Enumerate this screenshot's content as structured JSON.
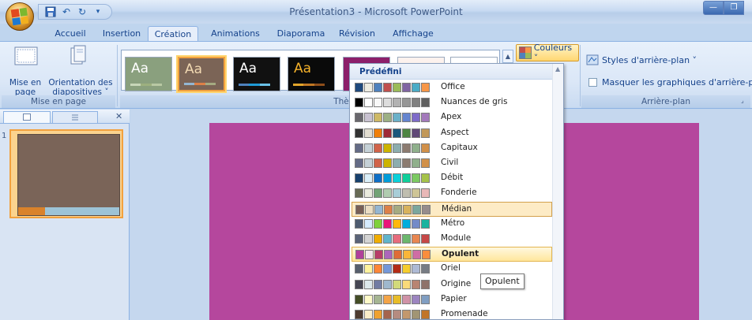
{
  "window": {
    "title": "Présentation3 - Microsoft PowerPoint"
  },
  "tabs": [
    {
      "label": "Accueil"
    },
    {
      "label": "Insertion"
    },
    {
      "label": "Création",
      "active": true
    },
    {
      "label": "Animations"
    },
    {
      "label": "Diaporama"
    },
    {
      "label": "Révision"
    },
    {
      "label": "Affichage"
    }
  ],
  "ribbon": {
    "page_group": {
      "mise_en_page_line1": "Mise en",
      "mise_en_page_line2": "page",
      "orientation_line1": "Orientation des",
      "orientation_line2": "diapositives ˅",
      "label": "Mise en page"
    },
    "themes_group": {
      "label": "Thè",
      "aa": "Aa"
    },
    "couleurs_label": "Couleurs ˅",
    "background_group": {
      "styles_label": "Styles d'arrière-plan ˅",
      "masquer_label": "Masquer les graphiques d'arrière-plan",
      "label": "Arrière-plan"
    }
  },
  "pane": {
    "slide_number": "1"
  },
  "dropdown": {
    "header": "Prédéfini",
    "items": [
      {
        "name": "Office",
        "colors": [
          "#1f497d",
          "#eeece1",
          "#4f81bd",
          "#c0504d",
          "#9bbb59",
          "#8064a2",
          "#4bacc6",
          "#f79646"
        ]
      },
      {
        "name": "Nuances de gris",
        "colors": [
          "#000000",
          "#ffffff",
          "#f8f8f8",
          "#dddddd",
          "#b2b2b2",
          "#969696",
          "#808080",
          "#5f5f5f"
        ]
      },
      {
        "name": "Apex",
        "colors": [
          "#69676d",
          "#c9c2d1",
          "#ceb966",
          "#9cb084",
          "#6bb1c9",
          "#6585cf",
          "#7e6bc9",
          "#a379bb"
        ]
      },
      {
        "name": "Aspect",
        "colors": [
          "#323232",
          "#e3ded1",
          "#f07f09",
          "#9f2936",
          "#1b587c",
          "#4e8542",
          "#604878",
          "#c19859"
        ]
      },
      {
        "name": "Capitaux",
        "colors": [
          "#646b86",
          "#c5d1d7",
          "#d16349",
          "#ccb400",
          "#8cadae",
          "#8c7b70",
          "#8fb08c",
          "#d19049"
        ]
      },
      {
        "name": "Civil",
        "colors": [
          "#646b86",
          "#c5d1d7",
          "#d16349",
          "#ccb400",
          "#8cadae",
          "#8c7b70",
          "#8fb08c",
          "#d19049"
        ]
      },
      {
        "name": "Débit",
        "colors": [
          "#17406d",
          "#dbeff9",
          "#0f6fc6",
          "#009dd9",
          "#0bd0d9",
          "#10cf9b",
          "#7cca62",
          "#a5c249"
        ]
      },
      {
        "name": "Fonderie",
        "colors": [
          "#676a55",
          "#eaebde",
          "#72a376",
          "#b0ccb0",
          "#a8cdd7",
          "#c0beaf",
          "#cec597",
          "#e8b7b7"
        ]
      },
      {
        "name": "Médian",
        "colors": [
          "#775f55",
          "#ebddc3",
          "#94b6d2",
          "#dd8047",
          "#a5ab81",
          "#d8b25c",
          "#7ba79d",
          "#968c8c"
        ]
      },
      {
        "name": "Métro",
        "colors": [
          "#4e5b6f",
          "#d6ecff",
          "#7fd13b",
          "#ea157a",
          "#feb80a",
          "#00addc",
          "#738ac8",
          "#1ab39f"
        ]
      },
      {
        "name": "Module",
        "colors": [
          "#5a6378",
          "#d4d4d4",
          "#f0ad00",
          "#60b5cc",
          "#e66c7d",
          "#6bb76d",
          "#e88651",
          "#c64847"
        ]
      },
      {
        "name": "Opulent",
        "colors": [
          "#b13f9a",
          "#f4e7ed",
          "#b83d68",
          "#ac66bb",
          "#de6c36",
          "#f9b639",
          "#cf6da4",
          "#fa8d3d"
        ]
      },
      {
        "name": "Oriel",
        "colors": [
          "#575f6d",
          "#fff39d",
          "#fe8637",
          "#7598d9",
          "#b32c16",
          "#f5cd2d",
          "#aebad5",
          "#777c84"
        ]
      },
      {
        "name": "Origine",
        "colors": [
          "#464653",
          "#dde9ec",
          "#727ca3",
          "#9fb8cd",
          "#d2da7a",
          "#fada7a",
          "#b88472",
          "#8e736a"
        ]
      },
      {
        "name": "Papier",
        "colors": [
          "#444d26",
          "#fefac9",
          "#a5b592",
          "#f3a447",
          "#e7bc29",
          "#d092a7",
          "#9c85c0",
          "#809ec2"
        ]
      },
      {
        "name": "Promenade",
        "colors": [
          "#4e3b30",
          "#fbeec9",
          "#f0a22e",
          "#a5644e",
          "#b58b80",
          "#c3986d",
          "#a19574",
          "#c17529"
        ]
      }
    ]
  },
  "tooltip": {
    "text": "Opulent"
  }
}
